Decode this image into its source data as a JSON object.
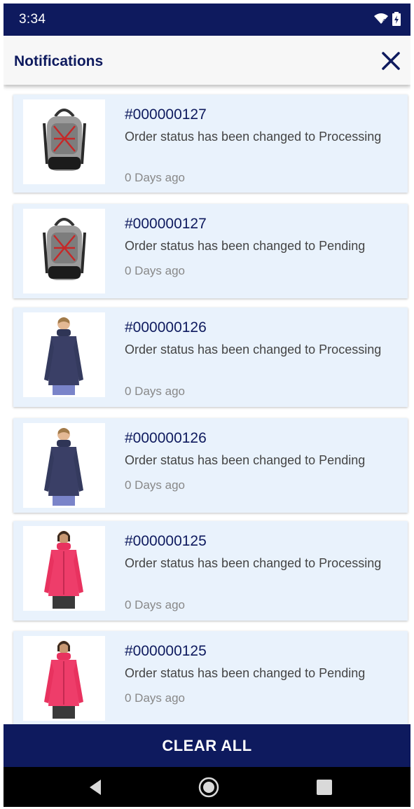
{
  "status_bar": {
    "time": "3:34"
  },
  "header": {
    "title": "Notifications",
    "close_icon": "close-icon"
  },
  "notifications": [
    {
      "order_id": "#000000127",
      "message": "Order status has been changed to Processing",
      "age": "0 Days ago",
      "product": "backpack"
    },
    {
      "order_id": "#000000127",
      "message": "Order status has been changed to Pending",
      "age": "0 Days ago",
      "product": "backpack"
    },
    {
      "order_id": "#000000126",
      "message": "Order status has been changed to Processing",
      "age": "0 Days ago",
      "product": "navy-jacket"
    },
    {
      "order_id": "#000000126",
      "message": "Order status has been changed to Pending",
      "age": "0 Days ago",
      "product": "navy-jacket"
    },
    {
      "order_id": "#000000125",
      "message": "Order status has been changed to Processing",
      "age": "0 Days ago",
      "product": "pink-jacket"
    },
    {
      "order_id": "#000000125",
      "message": "Order status has been changed to Pending",
      "age": "0 Days ago",
      "product": "pink-jacket"
    }
  ],
  "footer": {
    "clear_all_label": "CLEAR ALL"
  },
  "nav": {
    "back_icon": "back-icon",
    "home_icon": "home-icon",
    "recents_icon": "recents-icon"
  },
  "colors": {
    "primary": "#0e1a5e",
    "card_bg": "#e9f2fc",
    "muted_text": "#888888"
  }
}
